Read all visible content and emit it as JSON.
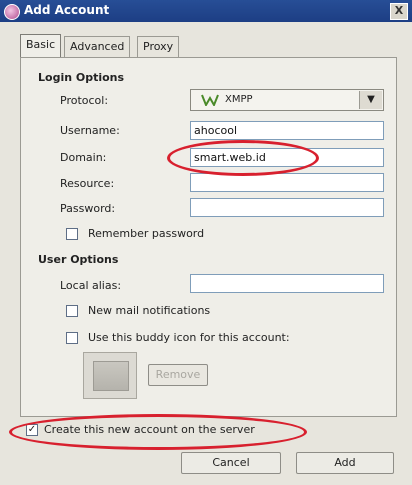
{
  "window": {
    "title": "Add Account",
    "close_label": "X"
  },
  "tabs": [
    {
      "label": "Basic",
      "active": true
    },
    {
      "label": "Advanced",
      "active": false
    },
    {
      "label": "Proxy",
      "active": false
    }
  ],
  "login_options": {
    "heading": "Login Options",
    "protocol": {
      "label": "Protocol:",
      "value": "XMPP"
    },
    "username": {
      "label": "Username:",
      "value": "ahocool"
    },
    "domain": {
      "label": "Domain:",
      "value": "smart.web.id"
    },
    "resource": {
      "label": "Resource:",
      "value": ""
    },
    "password": {
      "label": "Password:",
      "value": ""
    },
    "remember_password": {
      "label": "Remember password",
      "checked": false
    }
  },
  "user_options": {
    "heading": "User Options",
    "local_alias": {
      "label": "Local alias:",
      "value": ""
    },
    "new_mail": {
      "label": "New mail notifications",
      "checked": false
    },
    "buddy_icon": {
      "label": "Use this buddy icon for this account:",
      "checked": false
    },
    "remove_label": "Remove"
  },
  "create_account": {
    "label": "Create this new account on the server",
    "checked": true
  },
  "buttons": {
    "cancel": "Cancel",
    "add": "Add"
  },
  "colors": {
    "titlebar": "#1d3e84",
    "annotation": "#d8202e",
    "window_bg": "#e7e5dd"
  },
  "icons": {
    "app": "pidgin-icon",
    "protocol": "xmpp-icon"
  }
}
